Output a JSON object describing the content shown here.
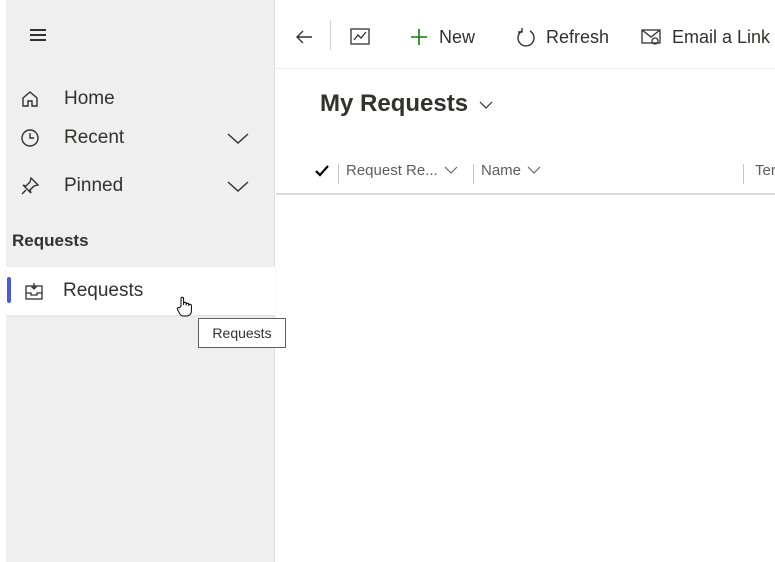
{
  "sidebar": {
    "menu_icon": "hamburger-icon",
    "items": [
      {
        "label": "Home",
        "icon": "home-icon"
      },
      {
        "label": "Recent",
        "icon": "clock-icon",
        "expandable": true
      },
      {
        "label": "Pinned",
        "icon": "pin-icon",
        "expandable": true
      }
    ],
    "group_title": "Requests",
    "selected_item": {
      "label": "Requests",
      "icon": "inbox-icon"
    },
    "tooltip": "Requests"
  },
  "toolbar": {
    "back_icon": "back-arrow-icon",
    "chart_icon": "chart-icon",
    "new_label": "New",
    "refresh_label": "Refresh",
    "email_label": "Email a Link"
  },
  "view": {
    "title": "My Requests",
    "columns": [
      {
        "label": "Request Re..."
      },
      {
        "label": "Name"
      },
      {
        "label": "Ter"
      }
    ]
  },
  "colors": {
    "accent": "#4a5cdb",
    "new_icon": "#107c10"
  }
}
